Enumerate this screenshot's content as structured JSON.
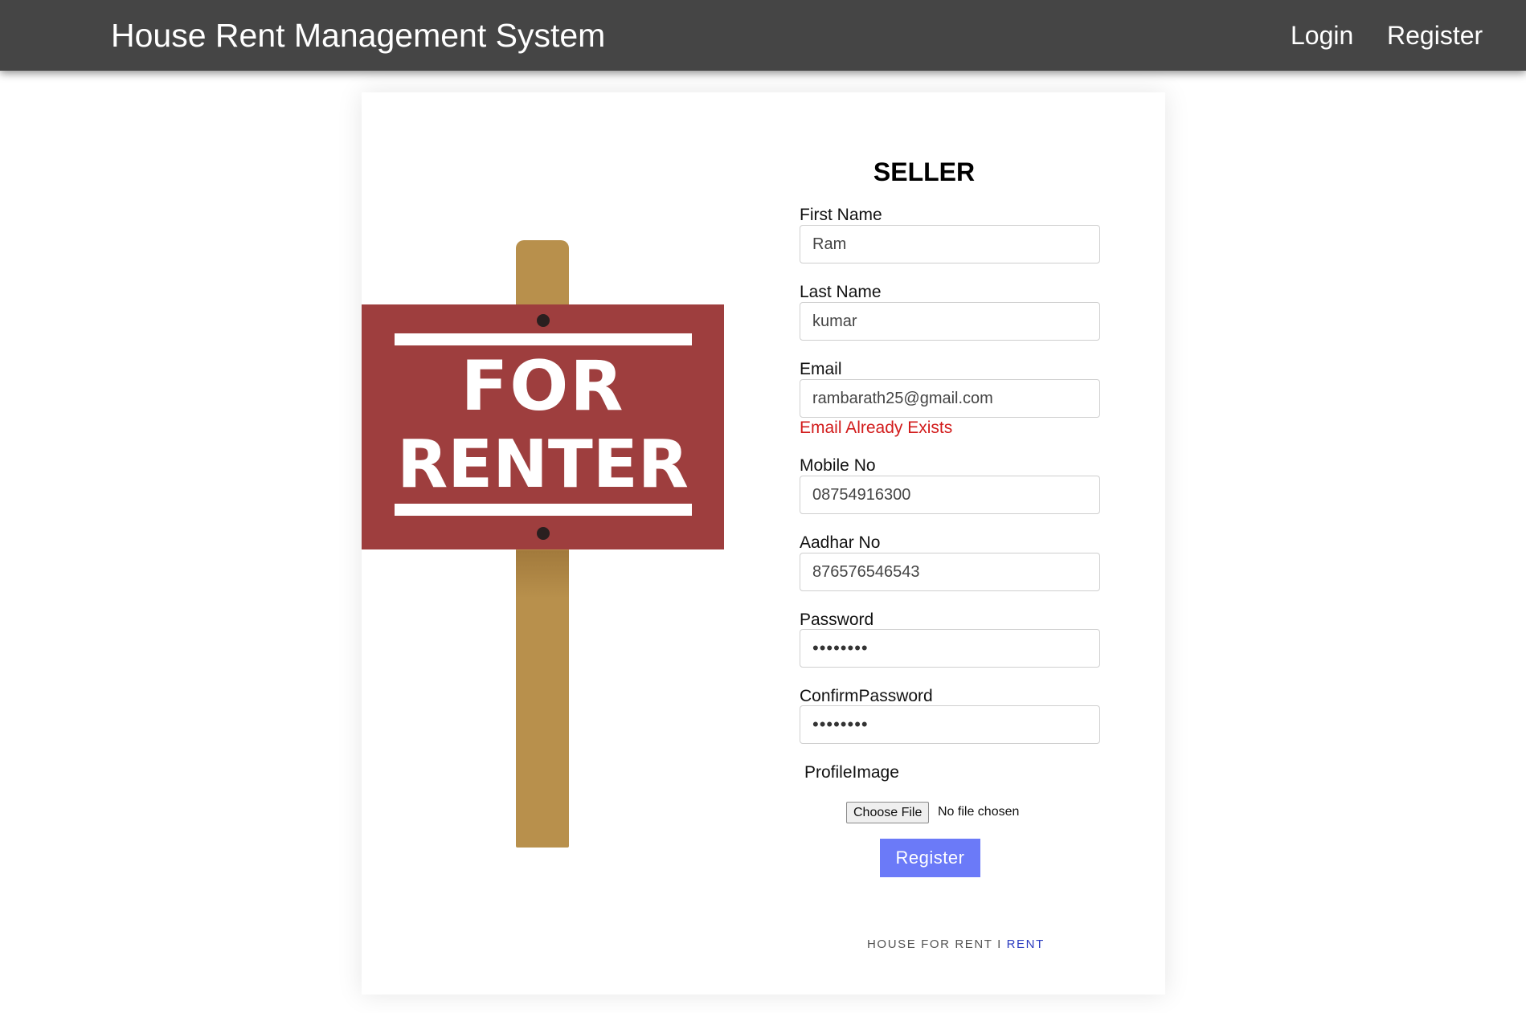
{
  "navbar": {
    "brand": "House Rent Management System",
    "login": "Login",
    "register": "Register"
  },
  "sign": {
    "line1": "FOR",
    "line2": "RENTER",
    "board_color": "#9e3e3e",
    "post_color": "#b8904c"
  },
  "form": {
    "title": "SELLER",
    "first_name": {
      "label": "First Name",
      "value": "Ram"
    },
    "last_name": {
      "label": "Last Name",
      "value": "kumar"
    },
    "email": {
      "label": "Email",
      "value": "rambarath25@gmail.com",
      "error": "Email Already Exists"
    },
    "mobile": {
      "label": "Mobile No",
      "value": "08754916300"
    },
    "aadhar": {
      "label": "Aadhar No",
      "value": "876576546543"
    },
    "password": {
      "label": "Password",
      "value": "••••••••"
    },
    "confirm_password": {
      "label": "ConfirmPassword",
      "value": "••••••••"
    },
    "profile_image": {
      "label": "ProfileImage",
      "button": "Choose File",
      "status": "No file chosen"
    },
    "submit": "Register",
    "submit_color": "#6b7af8",
    "error_color": "#d21b1b"
  },
  "footer": {
    "text": "HOUSE FOR RENT I",
    "link": "RENT"
  }
}
